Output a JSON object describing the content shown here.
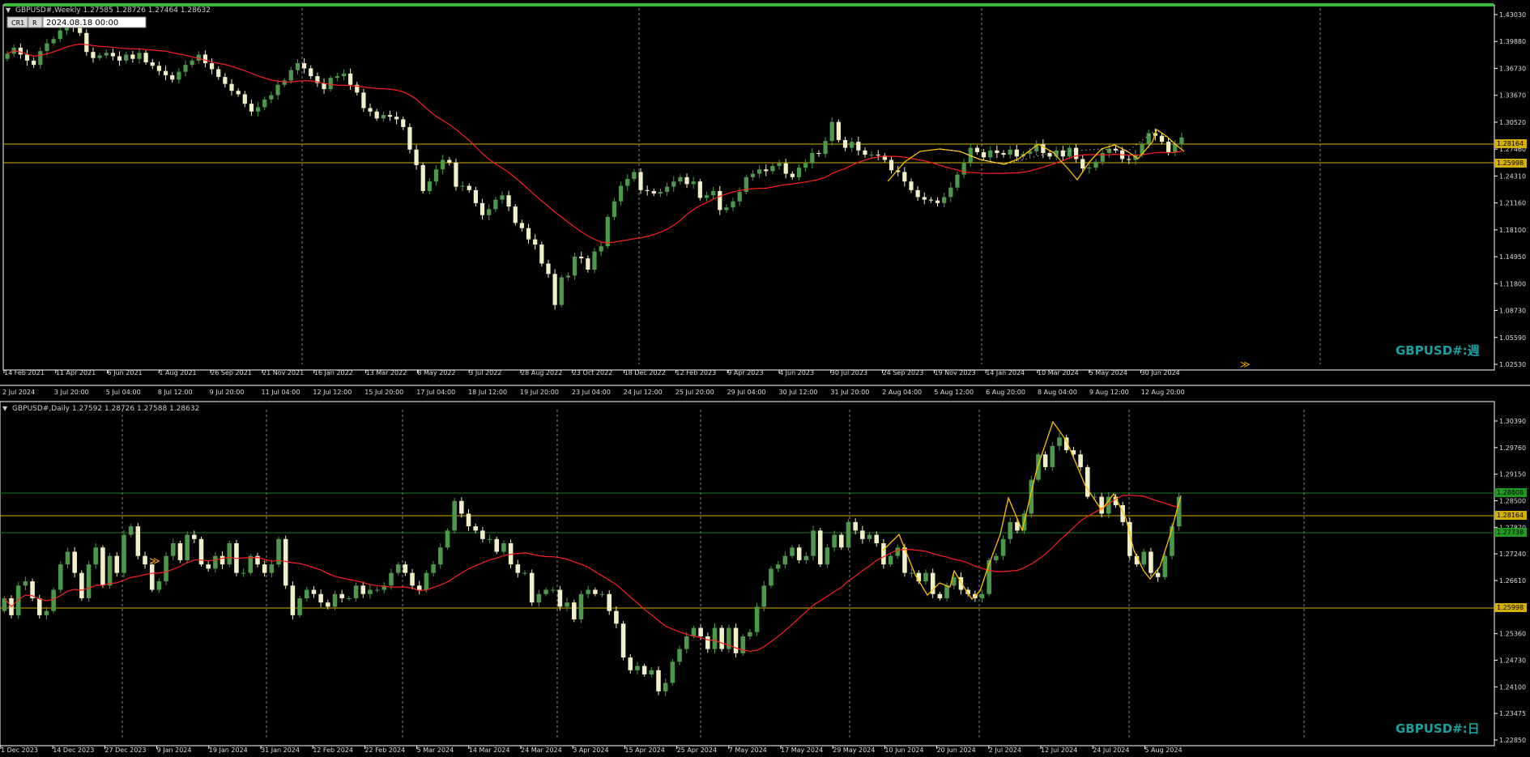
{
  "top_panel": {
    "header": "GBPUSD#,Weekly  1.27585 1.28726 1.27464 1.28632",
    "watermark": "GBPUSD#:週",
    "badge_cr": "CR1",
    "badge_r": "R",
    "date_input": "2024.08.18 00:00"
  },
  "bottom_panel": {
    "header": "GBPUSD#,Daily  1.27592 1.28726 1.27588 1.28632",
    "watermark": "GBPUSD#:日"
  },
  "scale_row": [
    "2 Jul 2024",
    "3 Jul 20:00",
    "5 Jul 04:00",
    "8 Jul 12:00",
    "9 Jul 20:00",
    "11 Jul 04:00",
    "12 Jul 12:00",
    "15 Jul 20:00",
    "17 Jul 04:00",
    "18 Jul 12:00",
    "19 Jul 20:00",
    "23 Jul 04:00",
    "24 Jul 12:00",
    "25 Jul 20:00",
    "29 Jul 04:00",
    "30 Jul 12:00",
    "31 Jul 20:00",
    "2 Aug 04:00",
    "5 Aug 12:00",
    "6 Aug 20:00",
    "8 Aug 04:00",
    "9 Aug 12:00",
    "12 Aug 20:00"
  ],
  "colors": {
    "bull": "#4a9a4a",
    "bear": "#f0f0c8",
    "ma": "#ff1f1f",
    "level": "#d4b000",
    "zigzag": "#ffc000",
    "watermark": "#1aa0a0",
    "frame": "#ffffff",
    "green_line": "#1f7a1f",
    "top_bar": "#38b838"
  },
  "chart_data": [
    {
      "type": "candlestick",
      "title": "GBPUSD#,Weekly",
      "open": 1.27585,
      "high": 1.28726,
      "low": 1.27464,
      "close": 1.28632,
      "ylim": [
        1.0253,
        1.4303
      ],
      "y_ticks": [
        1.4303,
        1.3988,
        1.3673,
        1.3367,
        1.3052,
        1.2746,
        1.2431,
        1.2116,
        1.181,
        1.1495,
        1.118,
        1.0873,
        1.0559,
        1.0253
      ],
      "x_labels": [
        "14 Feb 2021",
        "11 Apr 2021",
        "6 Jun 2021",
        "1 Aug 2021",
        "26 Sep 2021",
        "21 Nov 2021",
        "16 Jan 2022",
        "13 Mar 2022",
        "8 May 2022",
        "3 Jul 2022",
        "28 Aug 2022",
        "23 Oct 2022",
        "18 Dec 2022",
        "12 Feb 2023",
        "9 Apr 2023",
        "4 Jun 2023",
        "30 Jul 2023",
        "24 Sep 2023",
        "19 Nov 2023",
        "14 Jan 2024",
        "10 Mar 2024",
        "5 May 2024",
        "30 Jun 2024"
      ],
      "closes": [
        1.385,
        1.392,
        1.384,
        1.377,
        1.372,
        1.388,
        1.397,
        1.402,
        1.412,
        1.419,
        1.416,
        1.409,
        1.387,
        1.38,
        1.383,
        1.386,
        1.382,
        1.377,
        1.384,
        1.379,
        1.386,
        1.375,
        1.371,
        1.365,
        1.36,
        1.355,
        1.364,
        1.372,
        1.377,
        1.384,
        1.374,
        1.367,
        1.358,
        1.35,
        1.342,
        1.338,
        1.327,
        1.318,
        1.323,
        1.332,
        1.337,
        1.349,
        1.354,
        1.366,
        1.374,
        1.368,
        1.359,
        1.351,
        1.344,
        1.357,
        1.359,
        1.362,
        1.349,
        1.34,
        1.322,
        1.318,
        1.31,
        1.314,
        1.312,
        1.309,
        1.3,
        1.274,
        1.256,
        1.226,
        1.237,
        1.251,
        1.262,
        1.259,
        1.231,
        1.232,
        1.227,
        1.212,
        1.198,
        1.205,
        1.216,
        1.221,
        1.208,
        1.189,
        1.183,
        1.17,
        1.164,
        1.142,
        1.13,
        1.094,
        1.126,
        1.128,
        1.15,
        1.148,
        1.135,
        1.156,
        1.162,
        1.196,
        1.214,
        1.232,
        1.24,
        1.248,
        1.227,
        1.226,
        1.223,
        1.225,
        1.231,
        1.237,
        1.242,
        1.234,
        1.237,
        1.218,
        1.221,
        1.226,
        1.204,
        1.207,
        1.214,
        1.225,
        1.242,
        1.246,
        1.251,
        1.249,
        1.255,
        1.258,
        1.246,
        1.242,
        1.253,
        1.258,
        1.27,
        1.269,
        1.284,
        1.306,
        1.285,
        1.276,
        1.283,
        1.273,
        1.268,
        1.268,
        1.267,
        1.262,
        1.25,
        1.248,
        1.237,
        1.227,
        1.219,
        1.216,
        1.215,
        1.212,
        1.219,
        1.23,
        1.245,
        1.259,
        1.276,
        1.271,
        1.265,
        1.273,
        1.27,
        1.268,
        1.274,
        1.266,
        1.269,
        1.272,
        1.28,
        1.27,
        1.266,
        1.273,
        1.266,
        1.276,
        1.263,
        1.252,
        1.253,
        1.26,
        1.27,
        1.275,
        1.273,
        1.263,
        1.262,
        1.268,
        1.28,
        1.293,
        1.29,
        1.283,
        1.271,
        1.28,
        1.288
      ],
      "ma_period": 50
    },
    {
      "type": "candlestick",
      "title": "GBPUSD#,Daily",
      "open": 1.27592,
      "high": 1.28726,
      "low": 1.27588,
      "close": 1.28632,
      "ylim": [
        1.2285,
        1.3039
      ],
      "y_ticks": [
        1.3039,
        1.2976,
        1.2915,
        1.285,
        1.2787,
        1.2724,
        1.2661,
        1.2599,
        1.2536,
        1.2473,
        1.241,
        1.23475,
        1.2285
      ],
      "x_labels": [
        "1 Dec 2023",
        "14 Dec 2023",
        "27 Dec 2023",
        "9 Jan 2024",
        "19 Jan 2024",
        "31 Jan 2024",
        "12 Feb 2024",
        "22 Feb 2024",
        "5 Mar 2024",
        "14 Mar 2024",
        "24 Mar 2024",
        "3 Apr 2024",
        "15 Apr 2024",
        "25 Apr 2024",
        "7 May 2024",
        "17 May 2024",
        "29 May 2024",
        "10 Jun 2024",
        "20 Jun 2024",
        "2 Jul 2024",
        "12 Jul 2024",
        "24 Jul 2024",
        "5 Aug 2024"
      ],
      "price_labels": [
        "1.28808",
        "1.28164",
        "1.27738",
        "1.25998"
      ],
      "closes": [
        1.262,
        1.258,
        1.265,
        1.266,
        1.262,
        1.258,
        1.259,
        1.264,
        1.27,
        1.273,
        1.268,
        1.262,
        1.27,
        1.274,
        1.265,
        1.272,
        1.268,
        1.277,
        1.279,
        1.272,
        1.27,
        1.264,
        1.266,
        1.272,
        1.275,
        1.271,
        1.277,
        1.276,
        1.27,
        1.269,
        1.272,
        1.27,
        1.275,
        1.268,
        1.268,
        1.272,
        1.27,
        1.268,
        1.27,
        1.276,
        1.265,
        1.258,
        1.262,
        1.264,
        1.263,
        1.261,
        1.26,
        1.263,
        1.262,
        1.262,
        1.265,
        1.263,
        1.264,
        1.264,
        1.265,
        1.268,
        1.27,
        1.268,
        1.265,
        1.264,
        1.268,
        1.27,
        1.274,
        1.278,
        1.285,
        1.282,
        1.279,
        1.278,
        1.276,
        1.276,
        1.273,
        1.275,
        1.27,
        1.268,
        1.268,
        1.261,
        1.263,
        1.264,
        1.264,
        1.26,
        1.261,
        1.257,
        1.263,
        1.264,
        1.263,
        1.263,
        1.259,
        1.256,
        1.248,
        1.245,
        1.246,
        1.244,
        1.245,
        1.24,
        1.242,
        1.247,
        1.25,
        1.253,
        1.255,
        1.253,
        1.25,
        1.255,
        1.25,
        1.255,
        1.249,
        1.253,
        1.254,
        1.26,
        1.265,
        1.269,
        1.27,
        1.272,
        1.274,
        1.271,
        1.272,
        1.278,
        1.27,
        1.274,
        1.277,
        1.274,
        1.28,
        1.278,
        1.276,
        1.277,
        1.275,
        1.27,
        1.272,
        1.274,
        1.268,
        1.268,
        1.266,
        1.268,
        1.263,
        1.262,
        1.265,
        1.267,
        1.264,
        1.263,
        1.262,
        1.263,
        1.271,
        1.272,
        1.276,
        1.28,
        1.278,
        1.282,
        1.29,
        1.296,
        1.293,
        1.298,
        1.3,
        1.297,
        1.296,
        1.293,
        1.286,
        1.286,
        1.282,
        1.286,
        1.284,
        1.28,
        1.272,
        1.27,
        1.273,
        1.268,
        1.267,
        1.272,
        1.279,
        1.286
      ],
      "ma_period": 50
    }
  ]
}
